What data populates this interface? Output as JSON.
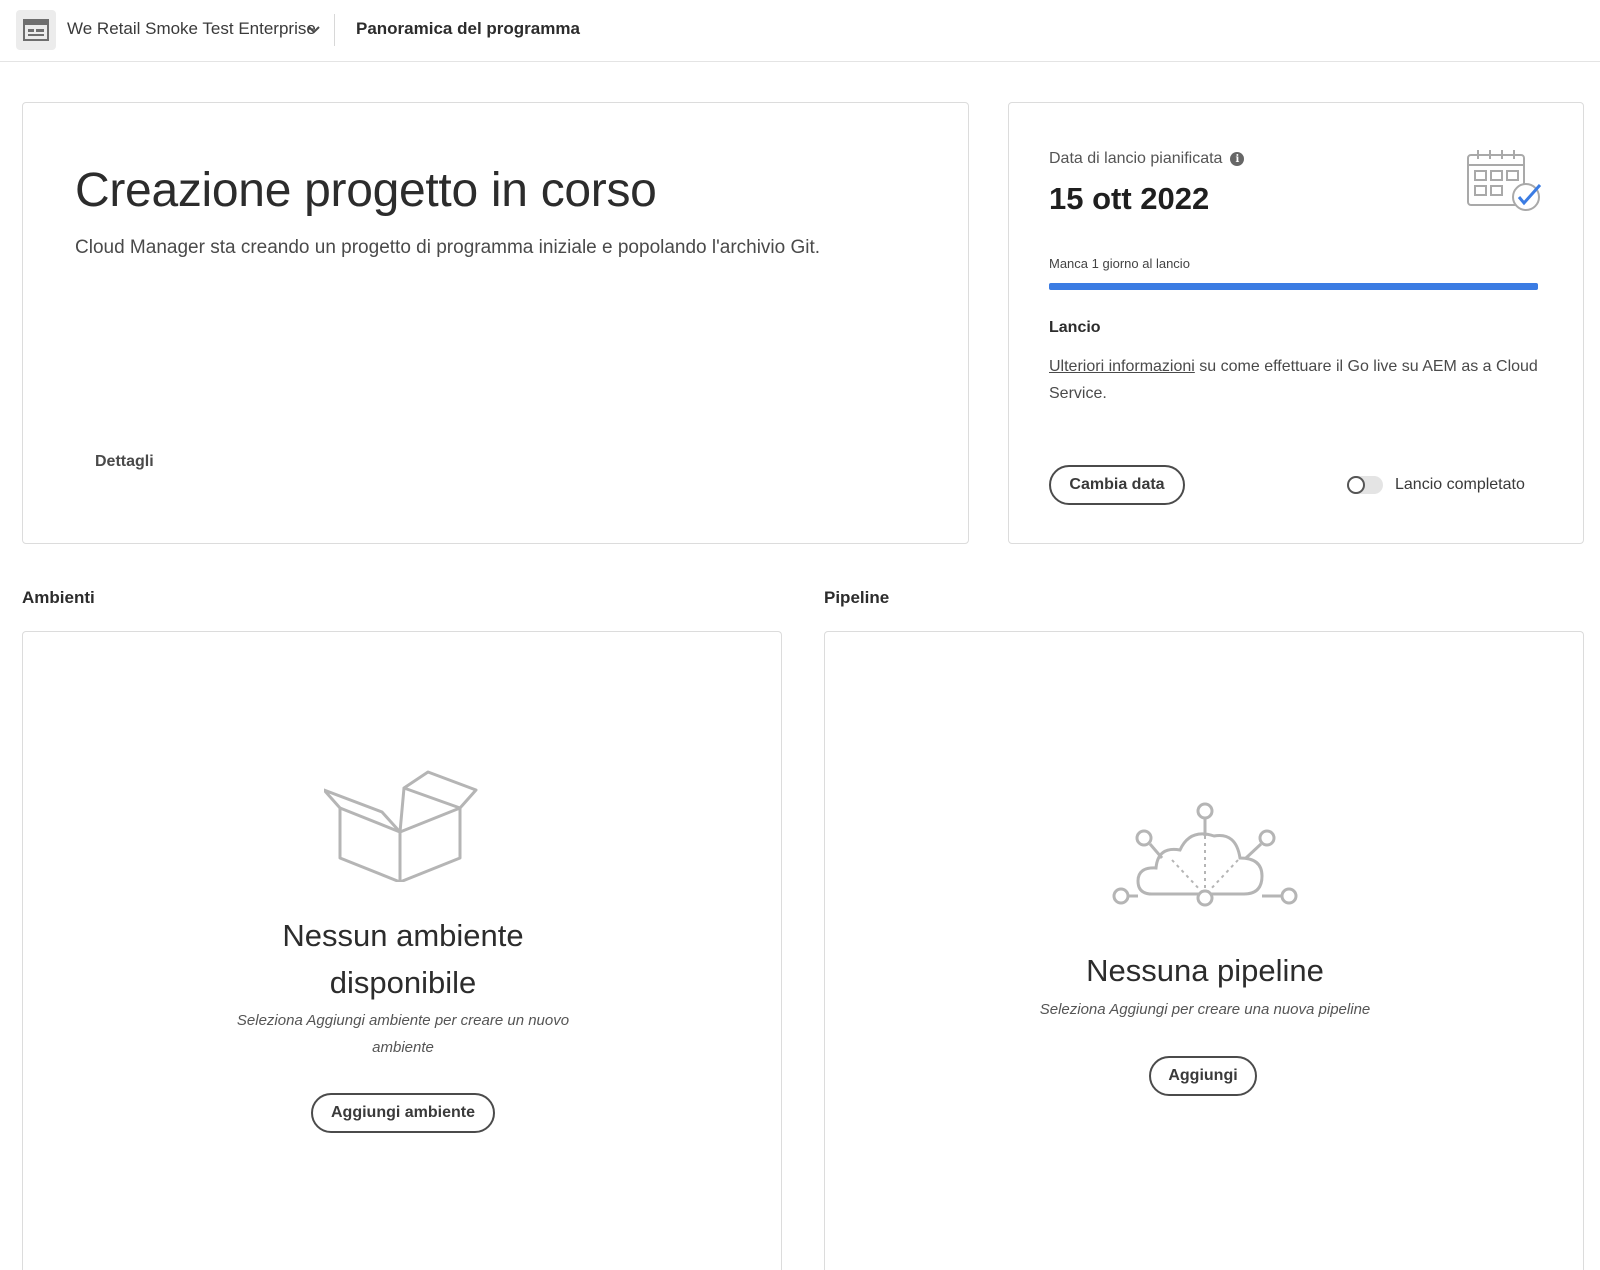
{
  "header": {
    "program_name": "We Retail Smoke Test Enterprise",
    "page_title": "Panoramica del programma"
  },
  "hero": {
    "title": "Creazione progetto in corso",
    "description": "Cloud Manager sta creando un progetto di programma iniziale e popolando l'archivio Git.",
    "details_link": "Dettagli"
  },
  "launch": {
    "label": "Data di lancio pianificata",
    "date": "15 ott 2022",
    "countdown": "Manca 1 giorno al lancio",
    "progress": 1.0,
    "progress_color": "#3b7ce3",
    "heading": "Lancio",
    "link_text": "Ulteriori informazioni",
    "text_after_link": " su come effettuare il Go live su AEM as a Cloud Service.",
    "change_date_button": "Cambia data",
    "completed_toggle_label": "Lancio completato",
    "completed": false
  },
  "environments": {
    "section_title": "Ambienti",
    "empty_title_line1": "Nessun ambiente",
    "empty_title_line2": "disponibile",
    "empty_desc_line1": "Seleziona Aggiungi ambiente per creare un nuovo",
    "empty_desc_line2": "ambiente",
    "add_button": "Aggiungi ambiente"
  },
  "pipelines": {
    "section_title": "Pipeline",
    "empty_title": "Nessuna pipeline",
    "empty_desc": "Seleziona Aggiungi per creare una nuova pipeline",
    "add_button": "Aggiungi"
  },
  "icons": {
    "program": "program-icon",
    "chevron": "chevron-down-icon",
    "info": "info-icon",
    "calendar": "calendar-check-icon",
    "box": "empty-box-icon",
    "cloud": "cloud-network-icon"
  }
}
